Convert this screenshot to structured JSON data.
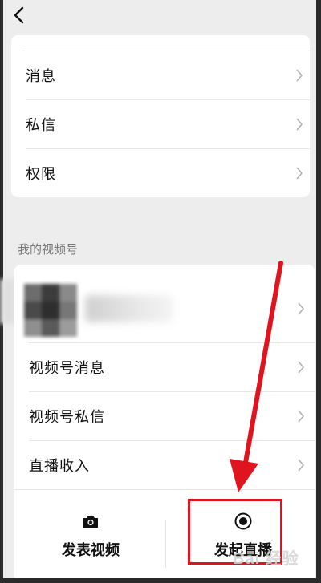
{
  "top_card": {
    "items": [
      {
        "label": "消息"
      },
      {
        "label": "私信"
      },
      {
        "label": "权限"
      }
    ]
  },
  "section_header": "我的视频号",
  "channel_card": {
    "items": [
      {
        "label": "视频号消息"
      },
      {
        "label": "视频号私信"
      },
      {
        "label": "直播收入"
      }
    ],
    "actions": [
      {
        "label": "发表视频",
        "icon": "camera-icon"
      },
      {
        "label": "发起直播",
        "icon": "live-record-icon"
      }
    ]
  },
  "watermark": "Bai 经验",
  "colors": {
    "background": "#ededed",
    "card": "#ffffff",
    "annotation_red": "#e0141e",
    "chevron": "#b2b2b2"
  }
}
